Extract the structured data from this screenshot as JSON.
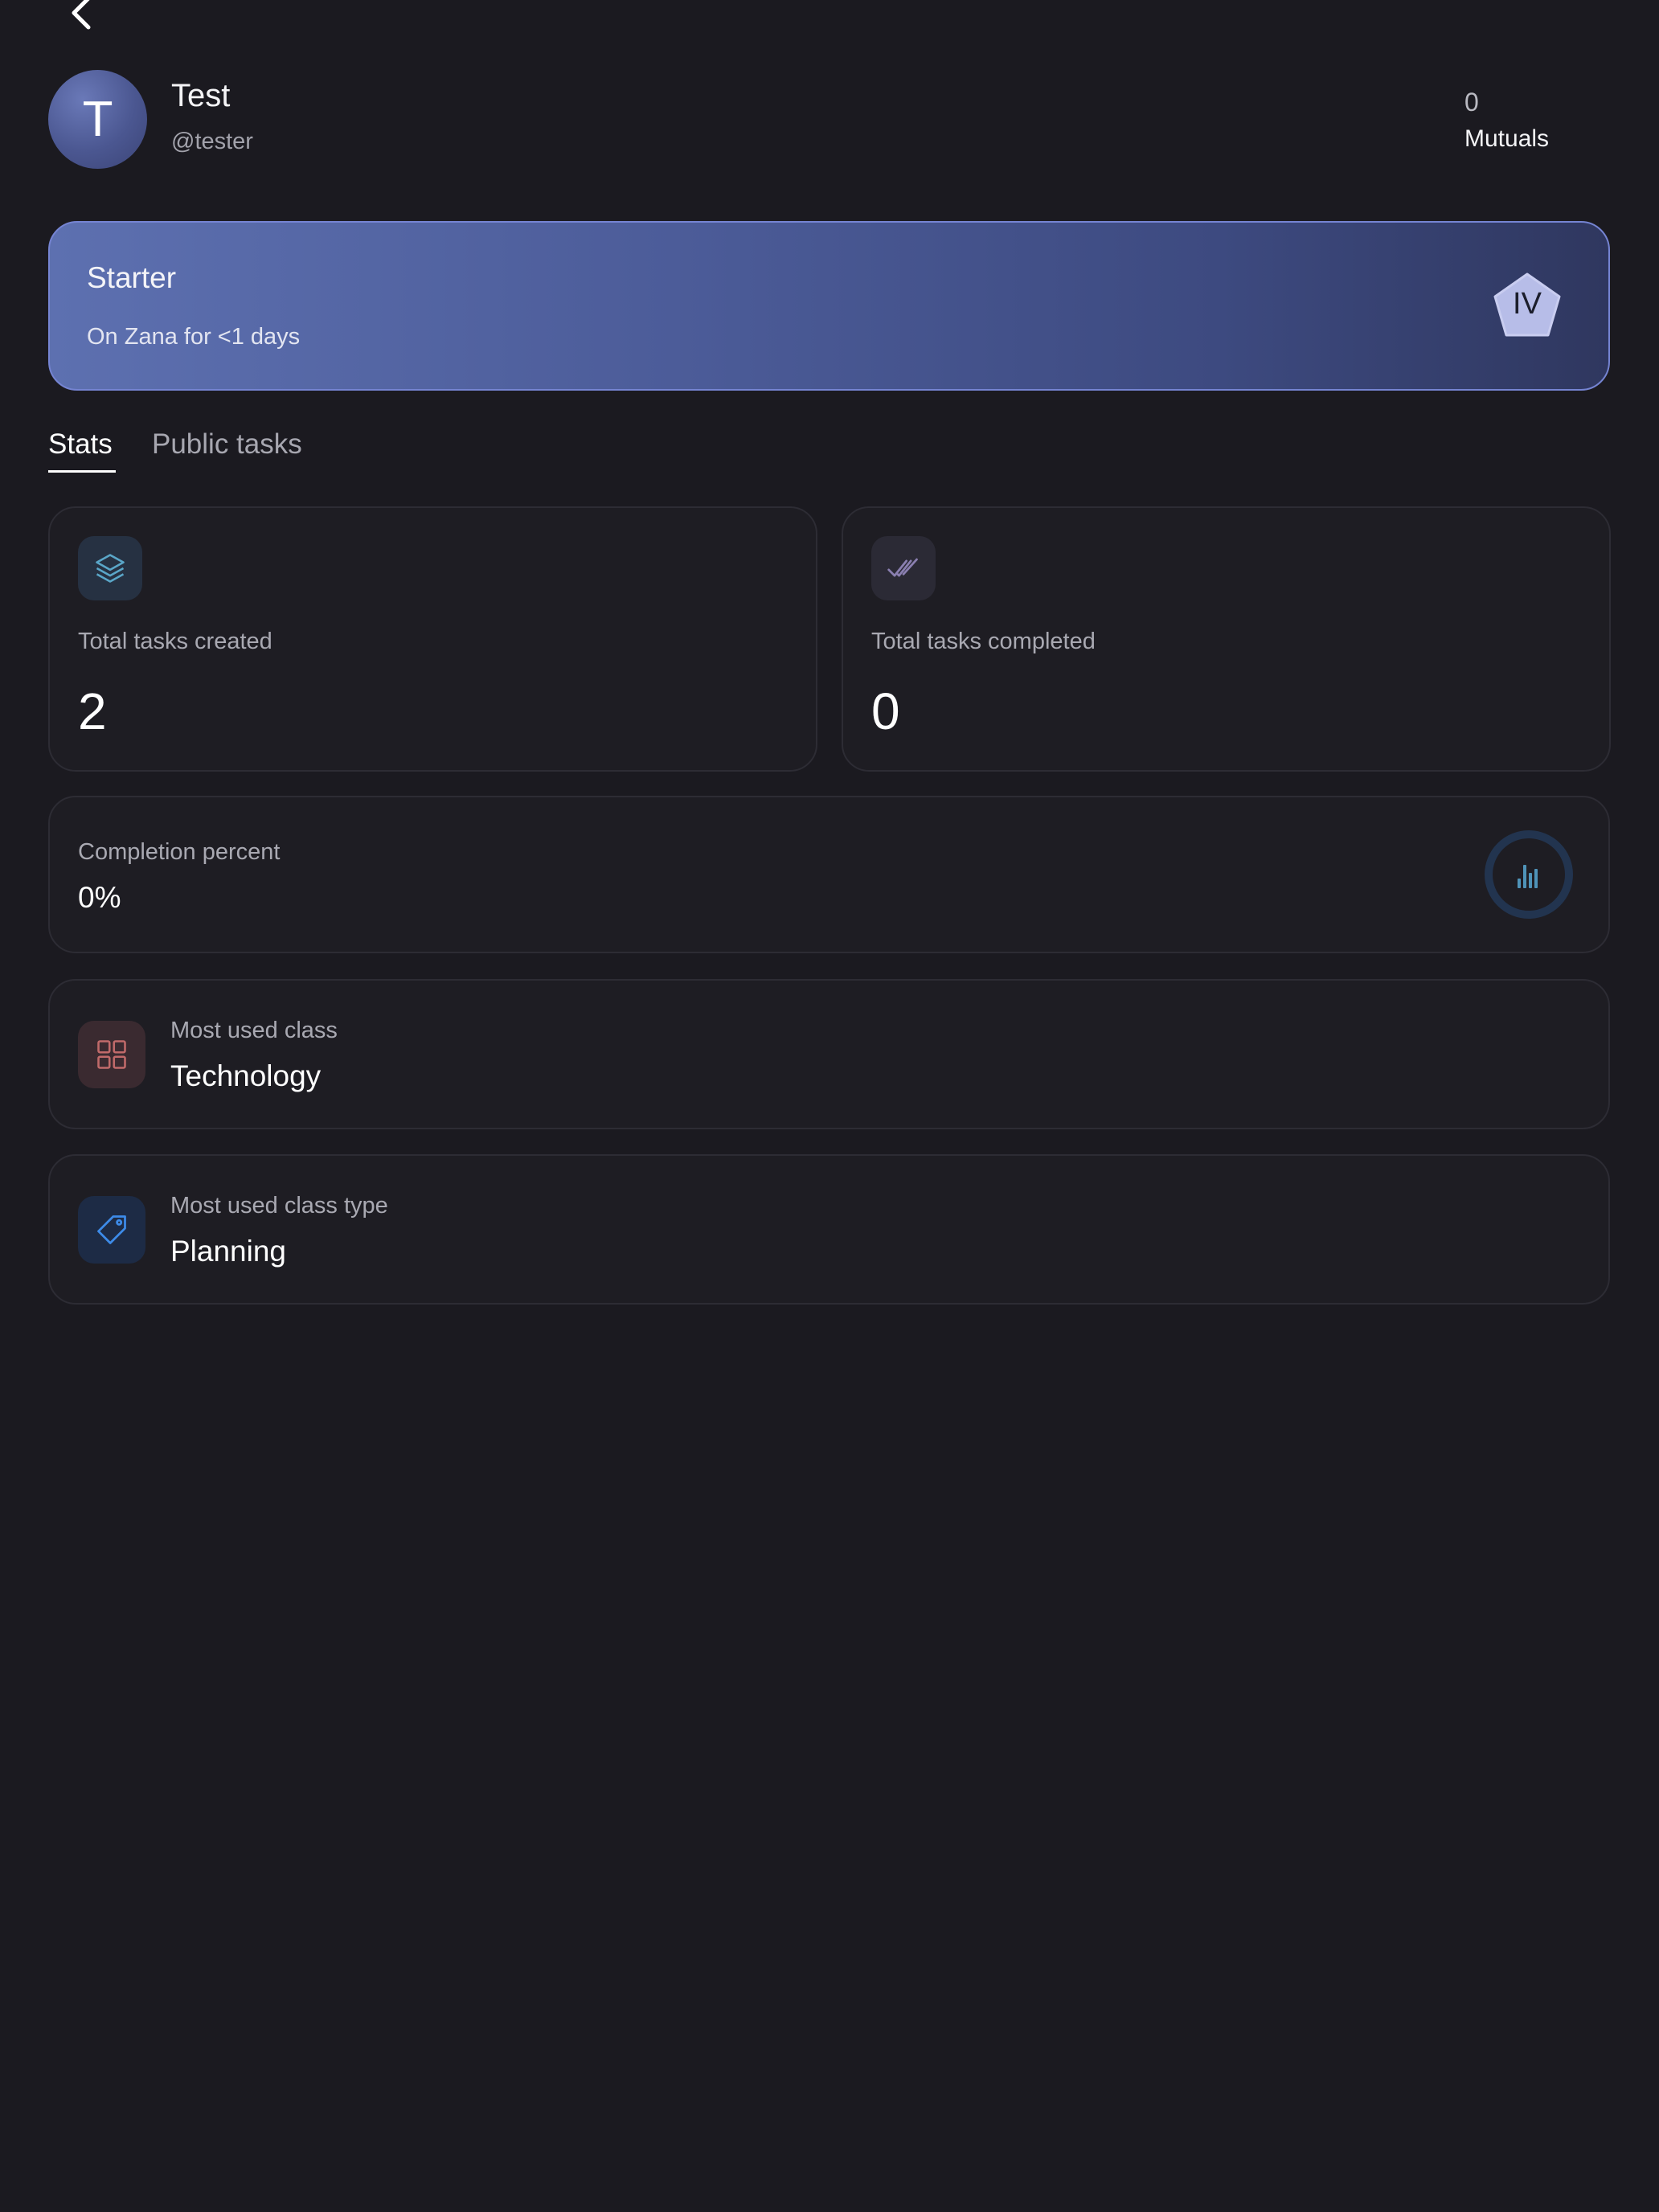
{
  "header": {
    "back_icon": "chevron-left-icon"
  },
  "profile": {
    "avatar_initial": "T",
    "name": "Test",
    "handle": "@tester",
    "mutuals_count": "0",
    "mutuals_label": "Mutuals"
  },
  "banner": {
    "title": "Starter",
    "subtitle": "On Zana for <1 days",
    "badge": "IV"
  },
  "tabs": [
    {
      "label": "Stats",
      "active": true
    },
    {
      "label": "Public tasks",
      "active": false
    }
  ],
  "stats": {
    "created": {
      "icon": "layers-icon",
      "label": "Total tasks created",
      "value": "2"
    },
    "completed": {
      "icon": "double-check-icon",
      "label": "Total tasks completed",
      "value": "0"
    },
    "completion": {
      "icon": "bar-chart-icon",
      "label": "Completion percent",
      "value": "0%",
      "fraction": 0
    }
  },
  "most_used": {
    "class": {
      "icon": "grid-icon",
      "label": "Most used class",
      "value": "Technology"
    },
    "class_type": {
      "icon": "tag-icon",
      "label": "Most used class type",
      "value": "Planning"
    }
  },
  "colors": {
    "background": "#1b1a20",
    "banner_start": "#5d70b0",
    "banner_end": "#2f375f",
    "layers_icon": "#5aa6c8",
    "check_icon": "#8a7fb0",
    "grid_icon": "#c06a6a",
    "tag_icon": "#3d8be8",
    "ring": "#22344f",
    "ring_bars": "#4f93b8"
  }
}
